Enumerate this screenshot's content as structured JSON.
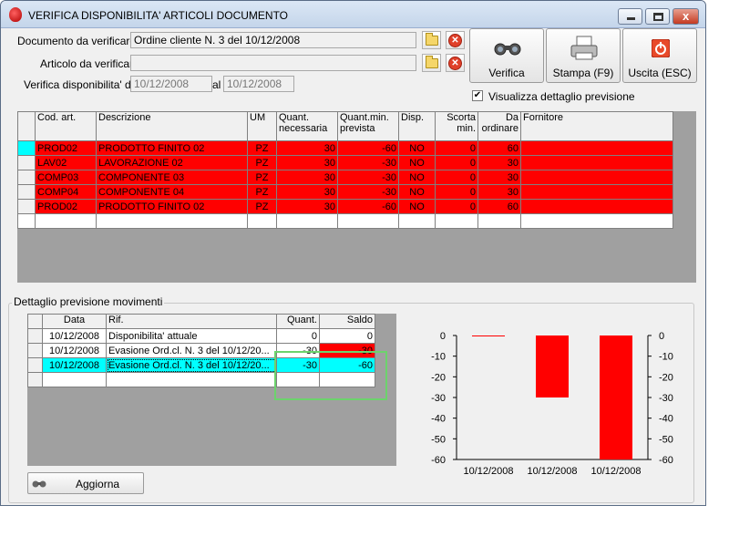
{
  "window": {
    "title": "VERIFICA DISPONIBILITA' ARTICOLI DOCUMENTO",
    "controls": [
      "minimize",
      "maximize",
      "close"
    ]
  },
  "form": {
    "documento_label": "Documento da verificare",
    "documento_value": "Ordine cliente N. 3 del 10/12/2008",
    "articolo_label": "Articolo da verificare",
    "articolo_value": "",
    "dal_label": "Verifica disponibilita' dal",
    "dal_value": "10/12/2008",
    "al_label": "al",
    "al_value": "10/12/2008"
  },
  "buttons": {
    "verifica": "Verifica",
    "stampa": "Stampa (F9)",
    "uscita": "Uscita (ESC)",
    "aggiorna": "Aggiorna"
  },
  "checkbox": {
    "label": "Visualizza dettaglio previsione",
    "checked": true,
    "mark": "✔"
  },
  "main_table": {
    "headers": [
      "Cod. art.",
      "Descrizione",
      "UM",
      "Quant. necessaria",
      "Quant.min. prevista",
      "Disp.",
      "Scorta min.",
      "Da ordinare",
      "Fornitore"
    ],
    "rows": [
      [
        "PROD02",
        "PRODOTTO FINITO 02",
        "PZ",
        "30",
        "-60",
        "NO",
        "0",
        "60",
        ""
      ],
      [
        "LAV02",
        "LAVORAZIONE 02",
        "PZ",
        "30",
        "-30",
        "NO",
        "0",
        "30",
        ""
      ],
      [
        "COMP03",
        "COMPONENTE 03",
        "PZ",
        "30",
        "-30",
        "NO",
        "0",
        "30",
        ""
      ],
      [
        "COMP04",
        "COMPONENTE 04",
        "PZ",
        "30",
        "-30",
        "NO",
        "0",
        "30",
        ""
      ],
      [
        "PROD02",
        "PRODOTTO FINITO 02",
        "PZ",
        "30",
        "-60",
        "NO",
        "0",
        "60",
        ""
      ]
    ],
    "row_color": "#ff0000"
  },
  "detail": {
    "group_title": "Dettaglio previsione movimenti",
    "headers": [
      "Data",
      "Rif.",
      "Quant.",
      "Saldo"
    ],
    "rows": [
      [
        "10/12/2008",
        "Disponibilita' attuale",
        "0",
        "0"
      ],
      [
        "10/12/2008",
        "Evasione Ord.cl. N. 3 del 10/12/20...",
        "-30",
        "-30"
      ],
      [
        "10/12/2008",
        "Evasione Ord.cl. N. 3 del 10/12/20...",
        "-30",
        "-60"
      ]
    ],
    "selected_color": "#00ffff"
  },
  "chart_data": {
    "type": "bar",
    "categories": [
      "10/12/2008",
      "10/12/2008",
      "10/12/2008"
    ],
    "values": [
      0,
      -30,
      -60
    ],
    "ylim": [
      -60,
      0
    ],
    "yticks": [
      0,
      -10,
      -20,
      -30,
      -40,
      -50,
      -60
    ],
    "bar_color": "#ff0000",
    "grid": false,
    "title": "",
    "xlabel": "",
    "ylabel": ""
  }
}
